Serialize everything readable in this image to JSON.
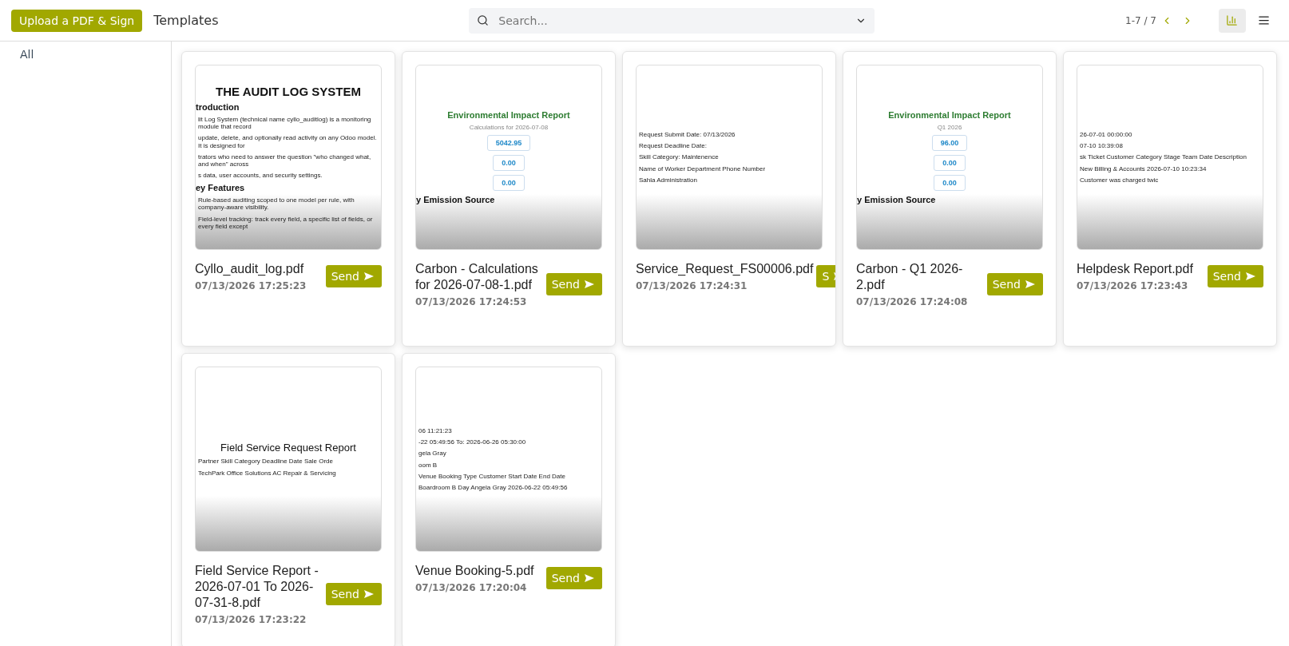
{
  "toolbar": {
    "upload_button": "Upload a PDF & Sign",
    "title": "Templates",
    "search": {
      "placeholder": "Search..."
    },
    "pager": "1-7 / 7",
    "views": [
      {
        "kind": "chart",
        "selected": true
      },
      {
        "kind": "list",
        "selected": false
      }
    ]
  },
  "sidebar": {
    "items": [
      {
        "label": "All",
        "selected": true
      }
    ]
  },
  "cards": [
    {
      "name": "Cyllo_audit_log.pdf",
      "date": "07/13/2026 17:25:23",
      "send": "Send",
      "preview": [
        {
          "kind": "title",
          "text": "THE AUDIT LOG SYSTEM"
        },
        {
          "kind": "heading",
          "text": "troduction"
        },
        {
          "kind": "text",
          "text": "lit Log System (technical name cyllo_auditlog) is a monitoring module that record"
        },
        {
          "kind": "text",
          "text": "update, delete, and optionally read activity on any Odoo model. It is designed for"
        },
        {
          "kind": "text",
          "text": "trators who need to answer the question \"who changed what, and when\" across"
        },
        {
          "kind": "text",
          "text": "s data, user accounts, and security settings."
        },
        {
          "kind": "heading",
          "text": "ey Features"
        },
        {
          "kind": "text",
          "text": "Rule-based auditing scoped to one model per rule, with company-aware visibility."
        },
        {
          "kind": "text",
          "text": "Field-level tracking: track every field, a specific list of fields, or every field except"
        }
      ]
    },
    {
      "name": "Carbon - Calculations for 2026-07-08-1.pdf",
      "date": "07/13/2026 17:24:53",
      "send": "Send",
      "preview": [
        {
          "kind": "report",
          "text": "Environmental Impact Report"
        },
        {
          "kind": "subtitle",
          "text": "Calculations for 2026-07-08"
        },
        {
          "kind": "stat",
          "text": "5042.95"
        },
        {
          "kind": "stat",
          "text": "0.00"
        },
        {
          "kind": "stat",
          "text": "0.00"
        },
        {
          "kind": "heading",
          "text": "y Emission Source"
        }
      ]
    },
    {
      "name": "Service_Request_FS00006.pdf",
      "date": "07/13/2026 17:24:31",
      "send": "S",
      "preview": [
        {
          "kind": "text",
          "text": "Request Submit Date:  07/13/2026"
        },
        {
          "kind": "text",
          "text": "Request Deadline Date:"
        },
        {
          "kind": "text",
          "text": "Skill Category:  Maintenence"
        },
        {
          "kind": "text",
          "text": "Name of Worker   Department   Phone Number"
        },
        {
          "kind": "text",
          "text": "Sahla   Administration"
        }
      ]
    },
    {
      "name": "Carbon - Q1 2026-2.pdf",
      "date": "07/13/2026 17:24:08",
      "send": "Send",
      "preview": [
        {
          "kind": "report",
          "text": "Environmental Impact Report"
        },
        {
          "kind": "subtitle",
          "text": "Q1 2026"
        },
        {
          "kind": "stat",
          "text": "96.00"
        },
        {
          "kind": "stat",
          "text": "0.00"
        },
        {
          "kind": "stat",
          "text": "0.00"
        },
        {
          "kind": "heading",
          "text": "y Emission Source"
        }
      ]
    },
    {
      "name": "Helpdesk Report.pdf",
      "date": "07/13/2026 17:23:43",
      "send": "Send",
      "preview": [
        {
          "kind": "text",
          "text": "26-07-01 00:00:00"
        },
        {
          "kind": "text",
          "text": "07-10 10:39:08"
        },
        {
          "kind": "text",
          "text": "sk Ticket  Customer  Category  Stage  Team  Date  Description"
        },
        {
          "kind": "text",
          "text": "New  Billing & Accounts  2026-07-10 10:23:34"
        },
        {
          "kind": "text",
          "text": "Customer was charged twic"
        }
      ]
    },
    {
      "name": "Field Service Report - 2026-07-01 To 2026-07-31-8.pdf",
      "date": "07/13/2026 17:23:22",
      "send": "Send",
      "preview": [
        {
          "kind": "plain_title",
          "text": "Field Service Request Report"
        },
        {
          "kind": "text",
          "text": "Partner   Skill Category   Deadline Date   Sale Orde"
        },
        {
          "kind": "text",
          "text": "TechPark Office Solutions   AC Repair & Servicing"
        }
      ]
    },
    {
      "name": "Venue Booking-5.pdf",
      "date": "07/13/2026 17:20:04",
      "send": "Send",
      "preview": [
        {
          "kind": "text",
          "text": "06 11:21:23"
        },
        {
          "kind": "text",
          "text": "-22 05:49:56   To: 2026-06-26 05:30:00"
        },
        {
          "kind": "text",
          "text": "gela Gray"
        },
        {
          "kind": "text",
          "text": "oom B"
        },
        {
          "kind": "text",
          "text": "Venue  Booking Type  Customer  Start Date  End Date"
        },
        {
          "kind": "text",
          "text": "Boardroom B  Day  Angela Gray  2026-06-22 05:49:56"
        }
      ]
    }
  ]
}
